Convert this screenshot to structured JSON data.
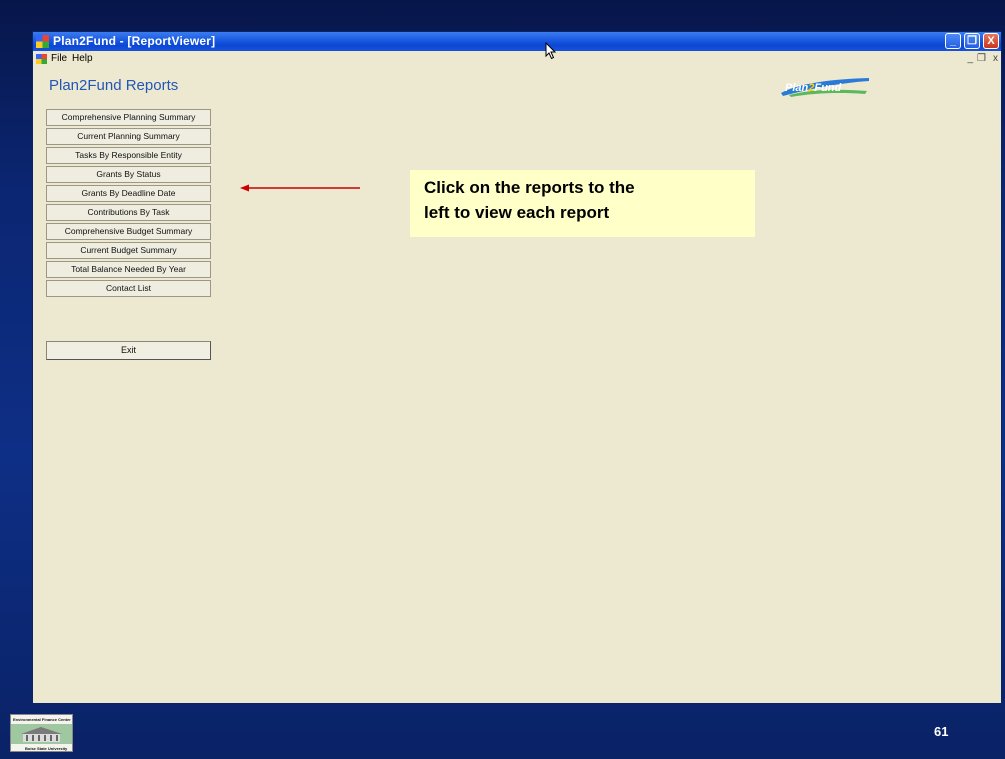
{
  "window": {
    "title": "Plan2Fund - [ReportViewer]",
    "controls": {
      "minimize": "_",
      "maximize": "❐",
      "close": "X"
    }
  },
  "menubar": {
    "items": [
      "File",
      "Help"
    ],
    "mdi_controls": {
      "minimize": "_",
      "restore": "❐",
      "close": "x"
    }
  },
  "app": {
    "heading": "Plan2Fund Reports",
    "logo_text_part1": "Plan",
    "logo_text_part2": "2",
    "logo_text_part3": "Fund",
    "reports": [
      "Comprehensive Planning Summary",
      "Current Planning Summary",
      "Tasks By Responsible Entity",
      "Grants By Status",
      "Grants By Deadline Date",
      "Contributions By Task",
      "Comprehensive Budget Summary",
      "Current Budget Summary",
      "Total Balance Needed By Year",
      "Contact List"
    ],
    "exit_label": "Exit"
  },
  "callout": {
    "line1": "Click on the reports to the",
    "line2": "left to view each report"
  },
  "slide": {
    "page_number": "61",
    "footer_logo_top": "Environmental Finance Center",
    "footer_logo_bottom": "Boise State University"
  },
  "colors": {
    "heading": "#2456b8",
    "arrow": "#cc0000",
    "callout_bg": "#ffffc8",
    "window_bg": "#ece9d0"
  }
}
